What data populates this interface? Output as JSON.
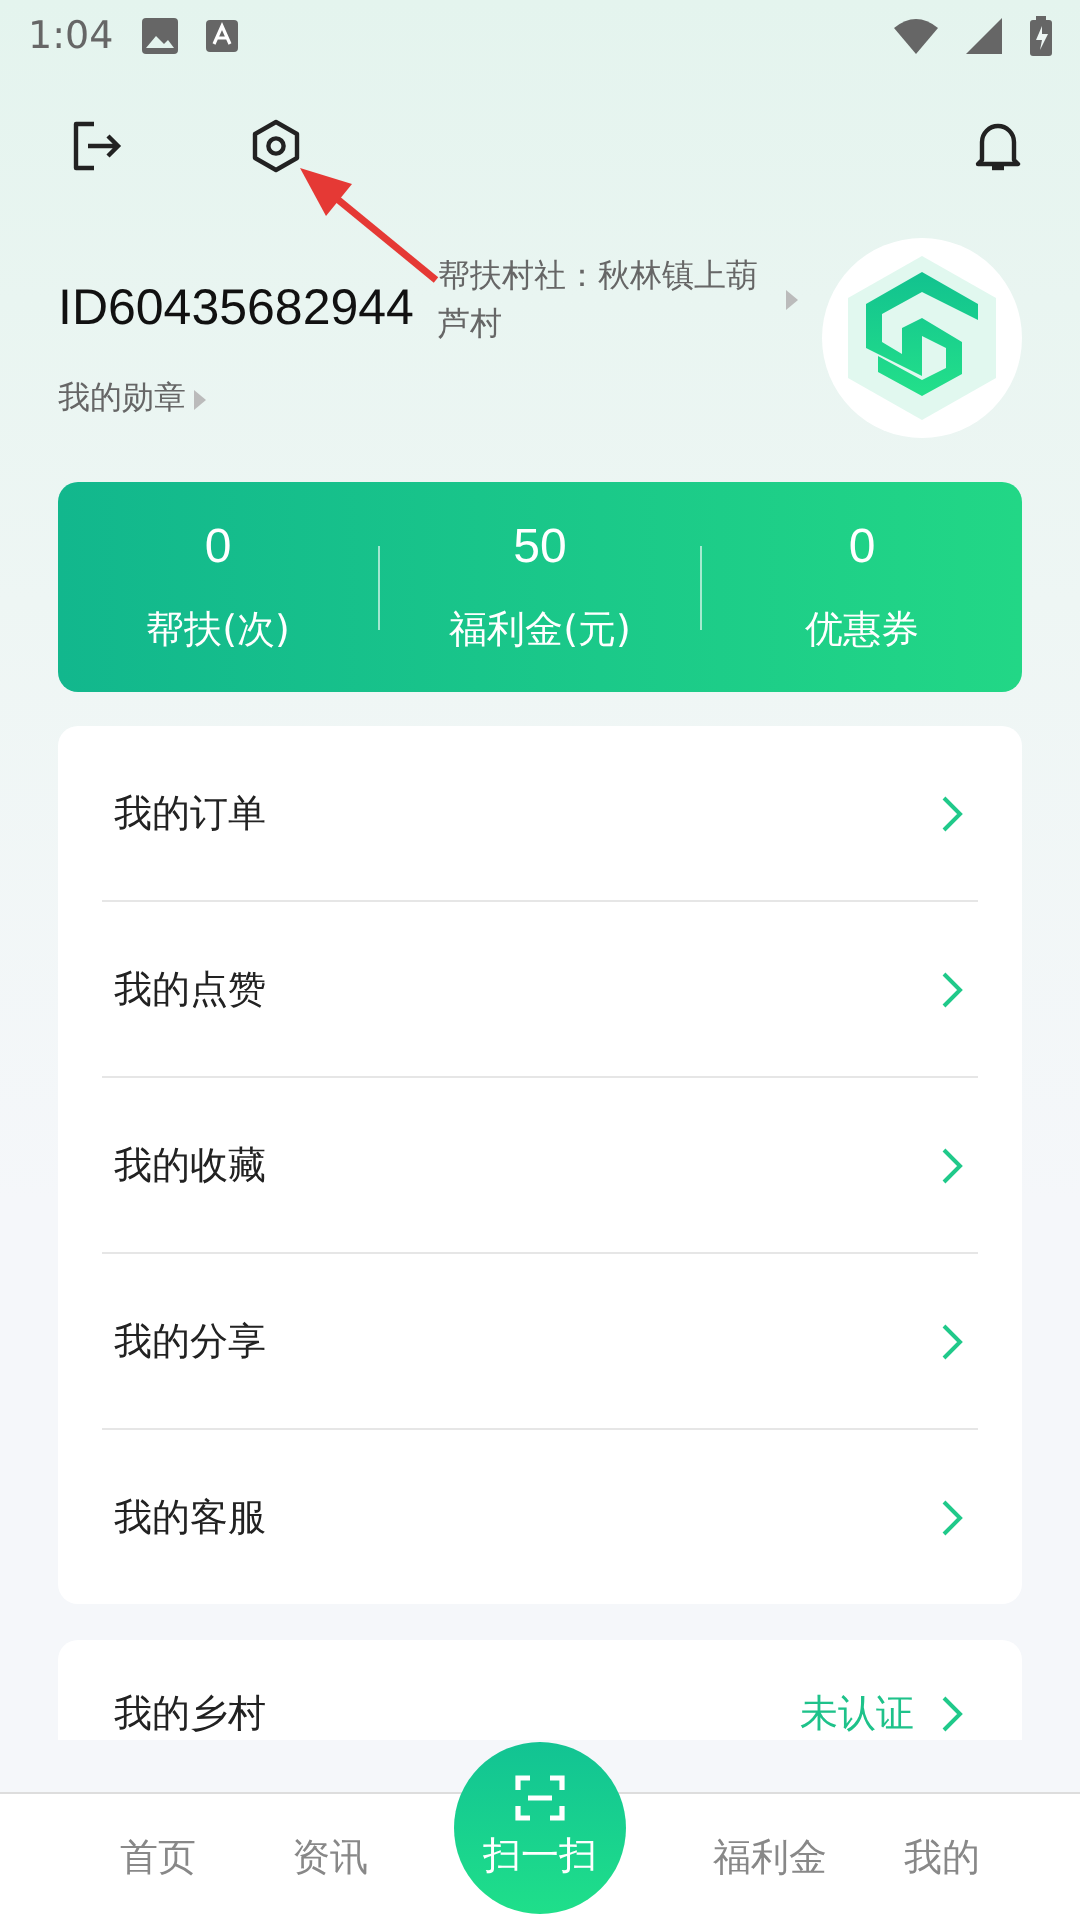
{
  "status_bar": {
    "time": "1:04"
  },
  "profile": {
    "user_id": "ID60435682944",
    "village": "帮扶村社：秋林镇上葫芦村",
    "badges_link": "我的勋章"
  },
  "stats": [
    {
      "value": "0",
      "label": "帮扶(次)"
    },
    {
      "value": "50",
      "label": "福利金(元)"
    },
    {
      "value": "0",
      "label": "优惠券"
    }
  ],
  "menu": {
    "items": [
      {
        "label": "我的订单"
      },
      {
        "label": "我的点赞"
      },
      {
        "label": "我的收藏"
      },
      {
        "label": "我的分享"
      },
      {
        "label": "我的客服"
      }
    ]
  },
  "village_row": {
    "label": "我的乡村",
    "value": "未认证"
  },
  "tab_bar": {
    "items": [
      {
        "label": "首页"
      },
      {
        "label": "资讯"
      }
    ],
    "scan": "扫一扫",
    "items_right": [
      {
        "label": "福利金"
      },
      {
        "label": "我的"
      }
    ]
  }
}
